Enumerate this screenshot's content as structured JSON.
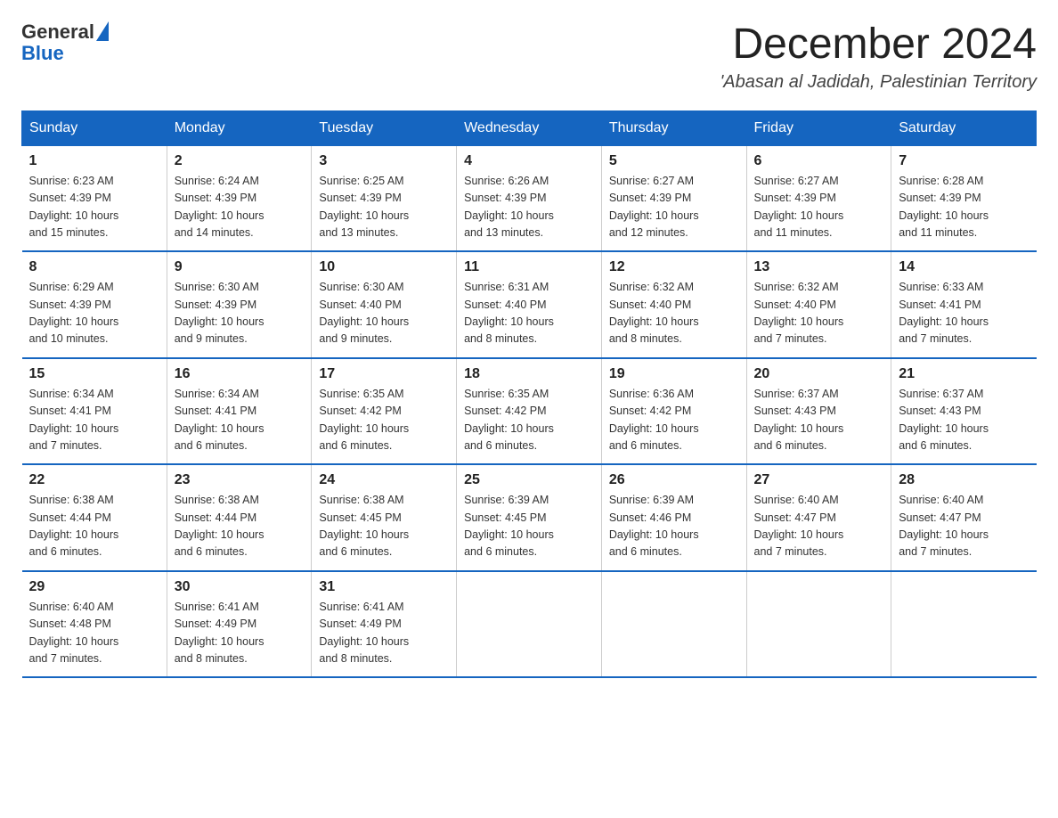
{
  "logo": {
    "general": "General",
    "blue": "Blue",
    "triangle": "▶"
  },
  "header": {
    "month_title": "December 2024",
    "location": "'Abasan al Jadidah, Palestinian Territory"
  },
  "days_of_week": [
    "Sunday",
    "Monday",
    "Tuesday",
    "Wednesday",
    "Thursday",
    "Friday",
    "Saturday"
  ],
  "weeks": [
    [
      {
        "num": "1",
        "sunrise": "6:23 AM",
        "sunset": "4:39 PM",
        "daylight": "10 hours and 15 minutes."
      },
      {
        "num": "2",
        "sunrise": "6:24 AM",
        "sunset": "4:39 PM",
        "daylight": "10 hours and 14 minutes."
      },
      {
        "num": "3",
        "sunrise": "6:25 AM",
        "sunset": "4:39 PM",
        "daylight": "10 hours and 13 minutes."
      },
      {
        "num": "4",
        "sunrise": "6:26 AM",
        "sunset": "4:39 PM",
        "daylight": "10 hours and 13 minutes."
      },
      {
        "num": "5",
        "sunrise": "6:27 AM",
        "sunset": "4:39 PM",
        "daylight": "10 hours and 12 minutes."
      },
      {
        "num": "6",
        "sunrise": "6:27 AM",
        "sunset": "4:39 PM",
        "daylight": "10 hours and 11 minutes."
      },
      {
        "num": "7",
        "sunrise": "6:28 AM",
        "sunset": "4:39 PM",
        "daylight": "10 hours and 11 minutes."
      }
    ],
    [
      {
        "num": "8",
        "sunrise": "6:29 AM",
        "sunset": "4:39 PM",
        "daylight": "10 hours and 10 minutes."
      },
      {
        "num": "9",
        "sunrise": "6:30 AM",
        "sunset": "4:39 PM",
        "daylight": "10 hours and 9 minutes."
      },
      {
        "num": "10",
        "sunrise": "6:30 AM",
        "sunset": "4:40 PM",
        "daylight": "10 hours and 9 minutes."
      },
      {
        "num": "11",
        "sunrise": "6:31 AM",
        "sunset": "4:40 PM",
        "daylight": "10 hours and 8 minutes."
      },
      {
        "num": "12",
        "sunrise": "6:32 AM",
        "sunset": "4:40 PM",
        "daylight": "10 hours and 8 minutes."
      },
      {
        "num": "13",
        "sunrise": "6:32 AM",
        "sunset": "4:40 PM",
        "daylight": "10 hours and 7 minutes."
      },
      {
        "num": "14",
        "sunrise": "6:33 AM",
        "sunset": "4:41 PM",
        "daylight": "10 hours and 7 minutes."
      }
    ],
    [
      {
        "num": "15",
        "sunrise": "6:34 AM",
        "sunset": "4:41 PM",
        "daylight": "10 hours and 7 minutes."
      },
      {
        "num": "16",
        "sunrise": "6:34 AM",
        "sunset": "4:41 PM",
        "daylight": "10 hours and 6 minutes."
      },
      {
        "num": "17",
        "sunrise": "6:35 AM",
        "sunset": "4:42 PM",
        "daylight": "10 hours and 6 minutes."
      },
      {
        "num": "18",
        "sunrise": "6:35 AM",
        "sunset": "4:42 PM",
        "daylight": "10 hours and 6 minutes."
      },
      {
        "num": "19",
        "sunrise": "6:36 AM",
        "sunset": "4:42 PM",
        "daylight": "10 hours and 6 minutes."
      },
      {
        "num": "20",
        "sunrise": "6:37 AM",
        "sunset": "4:43 PM",
        "daylight": "10 hours and 6 minutes."
      },
      {
        "num": "21",
        "sunrise": "6:37 AM",
        "sunset": "4:43 PM",
        "daylight": "10 hours and 6 minutes."
      }
    ],
    [
      {
        "num": "22",
        "sunrise": "6:38 AM",
        "sunset": "4:44 PM",
        "daylight": "10 hours and 6 minutes."
      },
      {
        "num": "23",
        "sunrise": "6:38 AM",
        "sunset": "4:44 PM",
        "daylight": "10 hours and 6 minutes."
      },
      {
        "num": "24",
        "sunrise": "6:38 AM",
        "sunset": "4:45 PM",
        "daylight": "10 hours and 6 minutes."
      },
      {
        "num": "25",
        "sunrise": "6:39 AM",
        "sunset": "4:45 PM",
        "daylight": "10 hours and 6 minutes."
      },
      {
        "num": "26",
        "sunrise": "6:39 AM",
        "sunset": "4:46 PM",
        "daylight": "10 hours and 6 minutes."
      },
      {
        "num": "27",
        "sunrise": "6:40 AM",
        "sunset": "4:47 PM",
        "daylight": "10 hours and 7 minutes."
      },
      {
        "num": "28",
        "sunrise": "6:40 AM",
        "sunset": "4:47 PM",
        "daylight": "10 hours and 7 minutes."
      }
    ],
    [
      {
        "num": "29",
        "sunrise": "6:40 AM",
        "sunset": "4:48 PM",
        "daylight": "10 hours and 7 minutes."
      },
      {
        "num": "30",
        "sunrise": "6:41 AM",
        "sunset": "4:49 PM",
        "daylight": "10 hours and 8 minutes."
      },
      {
        "num": "31",
        "sunrise": "6:41 AM",
        "sunset": "4:49 PM",
        "daylight": "10 hours and 8 minutes."
      },
      null,
      null,
      null,
      null
    ]
  ],
  "labels": {
    "sunrise": "Sunrise:",
    "sunset": "Sunset:",
    "daylight": "Daylight:"
  }
}
